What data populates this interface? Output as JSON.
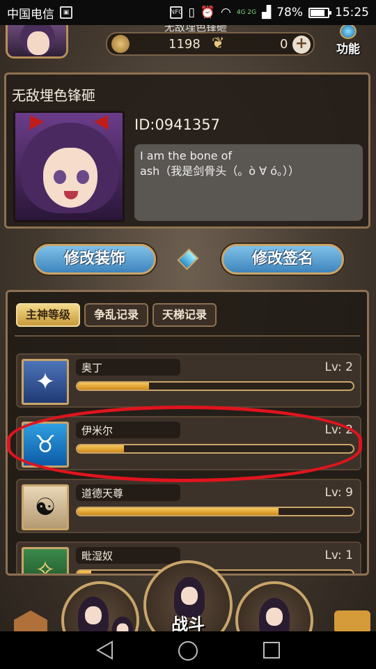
{
  "status_bar": {
    "carrier": "中国电信",
    "nfc": "NFC",
    "network": "4G 2G",
    "battery": "78%",
    "time": "15:25"
  },
  "top_bar": {
    "title_partial": "无敌埋色锋砸",
    "currency_a": "1198",
    "currency_b": "0",
    "function_label": "功能"
  },
  "profile": {
    "name": "无敌埋色锋砸",
    "id": "ID:0941357",
    "signature": "I am the bone of\nash（我是剑骨头（。ò ∀ ó。））"
  },
  "buttons": {
    "edit_decoration": "修改装饰",
    "edit_signature": "修改签名"
  },
  "tabs": [
    {
      "label": "主神等级",
      "active": true
    },
    {
      "label": "争乱记录",
      "active": false
    },
    {
      "label": "天梯记录",
      "active": false
    }
  ],
  "gods": [
    {
      "name": "奥丁",
      "level": "Lv: 2",
      "progress": 0.26,
      "icon": "odin-emblem-icon"
    },
    {
      "name": "伊米尔",
      "level": "Lv: 2",
      "progress": 0.17,
      "icon": "ymir-skull-icon"
    },
    {
      "name": "道德天尊",
      "level": "Lv: 9",
      "progress": 0.73,
      "icon": "taiji-icon"
    },
    {
      "name": "毗湿奴",
      "level": "Lv: 1",
      "progress": 0.05,
      "icon": "lotus-icon"
    }
  ],
  "bottom": {
    "battle_label": "战斗"
  },
  "colors": {
    "accent_gold": "#c9a56a",
    "progress_fill": "#f7c75a",
    "button_blue": "#3e85bd",
    "annotation_red": "#e0141e"
  }
}
